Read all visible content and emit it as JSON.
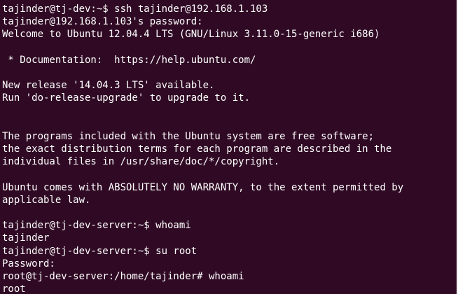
{
  "terminal": {
    "lines": [
      "tajinder@tj-dev:~$ ssh tajinder@192.168.1.103",
      "tajinder@192.168.1.103's password:",
      "Welcome to Ubuntu 12.04.4 LTS (GNU/Linux 3.11.0-15-generic i686)",
      "",
      " * Documentation:  https://help.ubuntu.com/",
      "",
      "New release '14.04.3 LTS' available.",
      "Run 'do-release-upgrade' to upgrade to it.",
      "",
      "",
      "The programs included with the Ubuntu system are free software;",
      "the exact distribution terms for each program are described in the",
      "individual files in /usr/share/doc/*/copyright.",
      "",
      "Ubuntu comes with ABSOLUTELY NO WARRANTY, to the extent permitted by",
      "applicable law.",
      "",
      "tajinder@tj-dev-server:~$ whoami",
      "tajinder",
      "tajinder@tj-dev-server:~$ su root",
      "Password:",
      "root@tj-dev-server:/home/tajinder# whoami",
      "root"
    ]
  },
  "colors": {
    "background": "#300a24",
    "foreground": "#ffffff"
  }
}
